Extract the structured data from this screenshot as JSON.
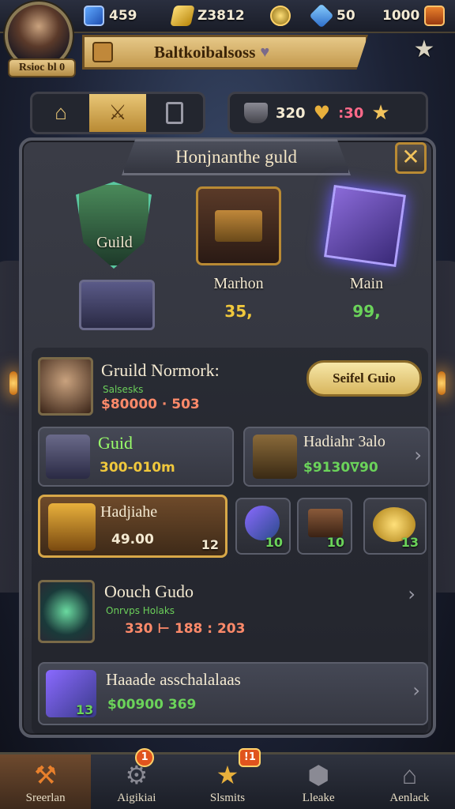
{
  "profile": {
    "label": "Rsioc bl 0"
  },
  "resources": {
    "blue_book": "459",
    "gold_bar": "Z3812",
    "crystal": "50",
    "chest_count": "1000"
  },
  "banner": {
    "title": "Baltkoibalsoss"
  },
  "tabs": [
    "home",
    "arena",
    "card"
  ],
  "currency": {
    "amount": "320",
    "gems": ":30"
  },
  "panel": {
    "title": "Honjnanthe guld"
  },
  "showcase": [
    {
      "label": "Guild",
      "price": ""
    },
    {
      "label": "Marhon",
      "price": "35,",
      "price_color": "#f0c83c"
    },
    {
      "label": "Main",
      "price": "99,",
      "price_color": "#6bd35a"
    }
  ],
  "guild_row": {
    "title": "Gruild Normork:",
    "sub": "Salsesks",
    "price": "$80000 · 503",
    "button": "Seifel Guio"
  },
  "cards": [
    {
      "title": "Guid",
      "price": "300-010m"
    },
    {
      "title": "Hadiahr 3alo",
      "price": "$9130∇90"
    }
  ],
  "featured": {
    "title": "Hadjiahe",
    "price": "49.00",
    "count": "12"
  },
  "slots": [
    "10",
    "10",
    "13"
  ],
  "ouch_row": {
    "title": "Oouch Gudo",
    "sub": "Onrvps Holaks",
    "price": "330 ⊢ 188 : 203"
  },
  "last_row": {
    "title": "Haaade asschalalaas",
    "price": "$00900 369",
    "count": "13"
  },
  "nav": [
    {
      "label": "Sreerlan",
      "badge": ""
    },
    {
      "label": "Aigikiai",
      "badge": "1"
    },
    {
      "label": "Slsmits",
      "badge": ""
    },
    {
      "label": "Lleake",
      "badge": ""
    },
    {
      "label": "Aenlack",
      "badge": ""
    }
  ],
  "nav_badge_2": "!1"
}
